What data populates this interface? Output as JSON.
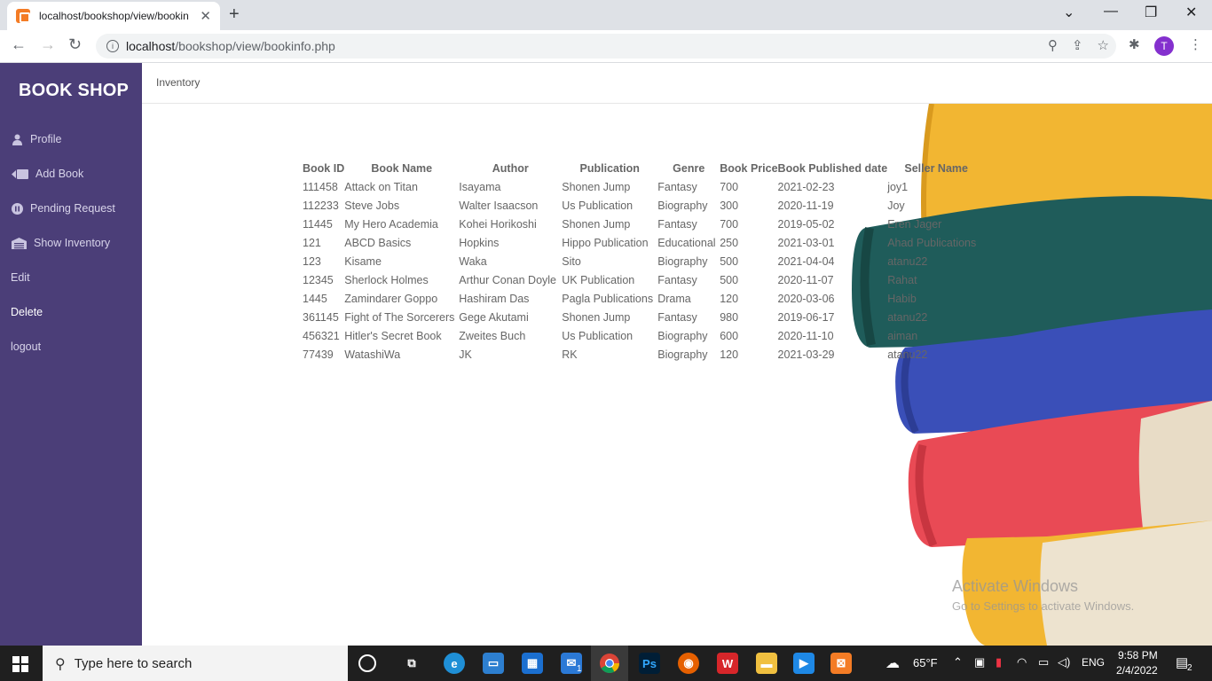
{
  "browser": {
    "tab_title": "localhost/bookshop/view/bookin",
    "url_host": "localhost",
    "url_path": "/bookshop/view/bookinfo.php",
    "profile_initial": "T"
  },
  "sidebar": {
    "brand": "BOOK SHOP",
    "items": [
      {
        "label": "Profile",
        "icon": "user-icon"
      },
      {
        "label": "Add Book",
        "icon": "add-book-icon"
      },
      {
        "label": "Pending Request",
        "icon": "pause-icon"
      },
      {
        "label": "Show Inventory",
        "icon": "warehouse-icon"
      },
      {
        "label": "Edit",
        "icon": ""
      },
      {
        "label": "Delete",
        "icon": ""
      },
      {
        "label": "logout",
        "icon": ""
      }
    ]
  },
  "topnav": {
    "link": "Inventory"
  },
  "table": {
    "headers": [
      "Book ID",
      "Book Name",
      "Author",
      "Publication",
      "Genre",
      "Book Price",
      "Book Published date",
      "Seller Name"
    ],
    "rows": [
      [
        "111458",
        "Attack on Titan",
        "Isayama",
        "Shonen Jump",
        "Fantasy",
        "700",
        "2021-02-23",
        "joy1"
      ],
      [
        "112233",
        "Steve Jobs",
        "Walter Isaacson",
        "Us Publication",
        "Biography",
        "300",
        "2020-11-19",
        "Joy"
      ],
      [
        "11445",
        "My Hero Academia",
        "Kohei Horikoshi",
        "Shonen Jump",
        "Fantasy",
        "700",
        "2019-05-02",
        "Eren Jager"
      ],
      [
        "121",
        "ABCD Basics",
        "Hopkins",
        "Hippo Publication",
        "Educational",
        "250",
        "2021-03-01",
        "Ahad Publications"
      ],
      [
        "123",
        "Kisame",
        "Waka",
        "Sito",
        "Biography",
        "500",
        "2021-04-04",
        "atanu22"
      ],
      [
        "12345",
        "Sherlock Holmes",
        "Arthur Conan Doyle",
        "UK Publication",
        "Fantasy",
        "500",
        "2020-11-07",
        "Rahat"
      ],
      [
        "1445",
        "Zamindarer Goppo",
        "Hashiram Das",
        "Pagla Publications",
        "Drama",
        "120",
        "2020-03-06",
        "Habib"
      ],
      [
        "361145",
        "Fight of The Sorcerers",
        "Gege Akutami",
        "Shonen Jump",
        "Fantasy",
        "980",
        "2019-06-17",
        "atanu22"
      ],
      [
        "456321",
        "Hitler's Secret Book",
        "Zweites Buch",
        "Us Publication",
        "Biography",
        "600",
        "2020-11-10",
        "aiman"
      ],
      [
        "77439",
        "WatashiWa",
        "JK",
        "RK",
        "Biography",
        "120",
        "2021-03-29",
        "atanu22"
      ]
    ]
  },
  "watermark": {
    "line1": "Activate Windows",
    "line2": "Go to Settings to activate Windows."
  },
  "taskbar": {
    "search_placeholder": "Type here to search",
    "weather": "65°F",
    "language": "ENG",
    "time": "9:58 PM",
    "date": "2/4/2022",
    "notification_count": "2",
    "mail_badge": "1"
  },
  "colors": {
    "sidebar_bg": "#4b3e78",
    "taskbar_bg": "#1f1f1f",
    "book_yellow": "#f2b632",
    "book_teal": "#1f5c5a",
    "book_blue": "#3a4fb8",
    "book_red": "#e94a55"
  }
}
